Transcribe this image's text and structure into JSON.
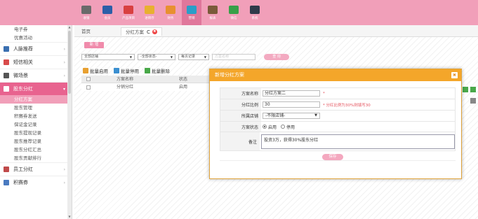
{
  "topnav": [
    {
      "label": "收银",
      "color": "#6a6a6a"
    },
    {
      "label": "会员",
      "color": "#2b5fa8"
    },
    {
      "label": "产品项目",
      "color": "#d84040"
    },
    {
      "label": "进销存",
      "color": "#e8b030"
    },
    {
      "label": "财务",
      "color": "#e89030"
    },
    {
      "label": "营销",
      "color": "#2a9ec8",
      "active": true
    },
    {
      "label": "报表",
      "color": "#7a5a3a"
    },
    {
      "label": "微信",
      "color": "#38a048"
    },
    {
      "label": "系统",
      "color": "#2f3a4a"
    }
  ],
  "sidebar": {
    "top_subitems": [
      "电子券",
      "优惠活动"
    ],
    "groups_before": [
      {
        "label": "人脉推荐",
        "icon": "people-icon",
        "color": "#3a6fb0"
      },
      {
        "label": "短信相关",
        "icon": "phone-icon",
        "color": "#d84a4a"
      },
      {
        "label": "微场景",
        "icon": "phone-scene-icon",
        "color": "#555555"
      }
    ],
    "active_group": {
      "label": "股东分红",
      "icon": "share-icon",
      "color": "#ffffff"
    },
    "sub_items": [
      "分红方案",
      "股东管理",
      "积赛券发送",
      "保证金记录",
      "股东提现记录",
      "股东推荐记录",
      "股东分红汇总",
      "股东贡献排行"
    ],
    "active_sub_index": 0,
    "groups_after": [
      {
        "label": "员工分红",
        "icon": "staff-icon",
        "color": "#c04a4a"
      },
      {
        "label": "积赛券",
        "icon": "coupon-icon",
        "color": "#4a7ac0"
      }
    ]
  },
  "tabs": {
    "home": "首页",
    "current": "分红方案",
    "refresh": "C",
    "close": "✖"
  },
  "toolbar": {
    "add": "新 增"
  },
  "filter": {
    "store": "全部店铺",
    "status": "-全部状态-",
    "page_size": "每页记录",
    "search_placeholder": "方案名称",
    "search_btn": "查 询"
  },
  "batch": {
    "enable": "批量启用",
    "disable": "批量停用",
    "delete": "批量删除"
  },
  "grid": {
    "headers": [
      "方案名称",
      "状态"
    ],
    "rows": [
      {
        "name": "分销分红",
        "status": "启用"
      }
    ]
  },
  "modal": {
    "title": "新增分红方案",
    "close": "✖",
    "fields": {
      "name_label": "方案名称",
      "name_value": "分红方案二",
      "name_required": "*",
      "ratio_label": "分红比例",
      "ratio_value": "30",
      "ratio_hint": "* 分红比例为30%则填写30",
      "store_label": "所属店铺",
      "store_value": "-不限店铺-",
      "status_label": "方案状态",
      "status_on": "启用",
      "status_off": "停用",
      "note_label": "备注",
      "note_value": "投资3万，获得30%股东分红"
    },
    "save": "保存"
  },
  "colors": {
    "brand_pink": "#f19fb9",
    "active_pink": "#e8638f",
    "modal_orange": "#f4a62a"
  }
}
